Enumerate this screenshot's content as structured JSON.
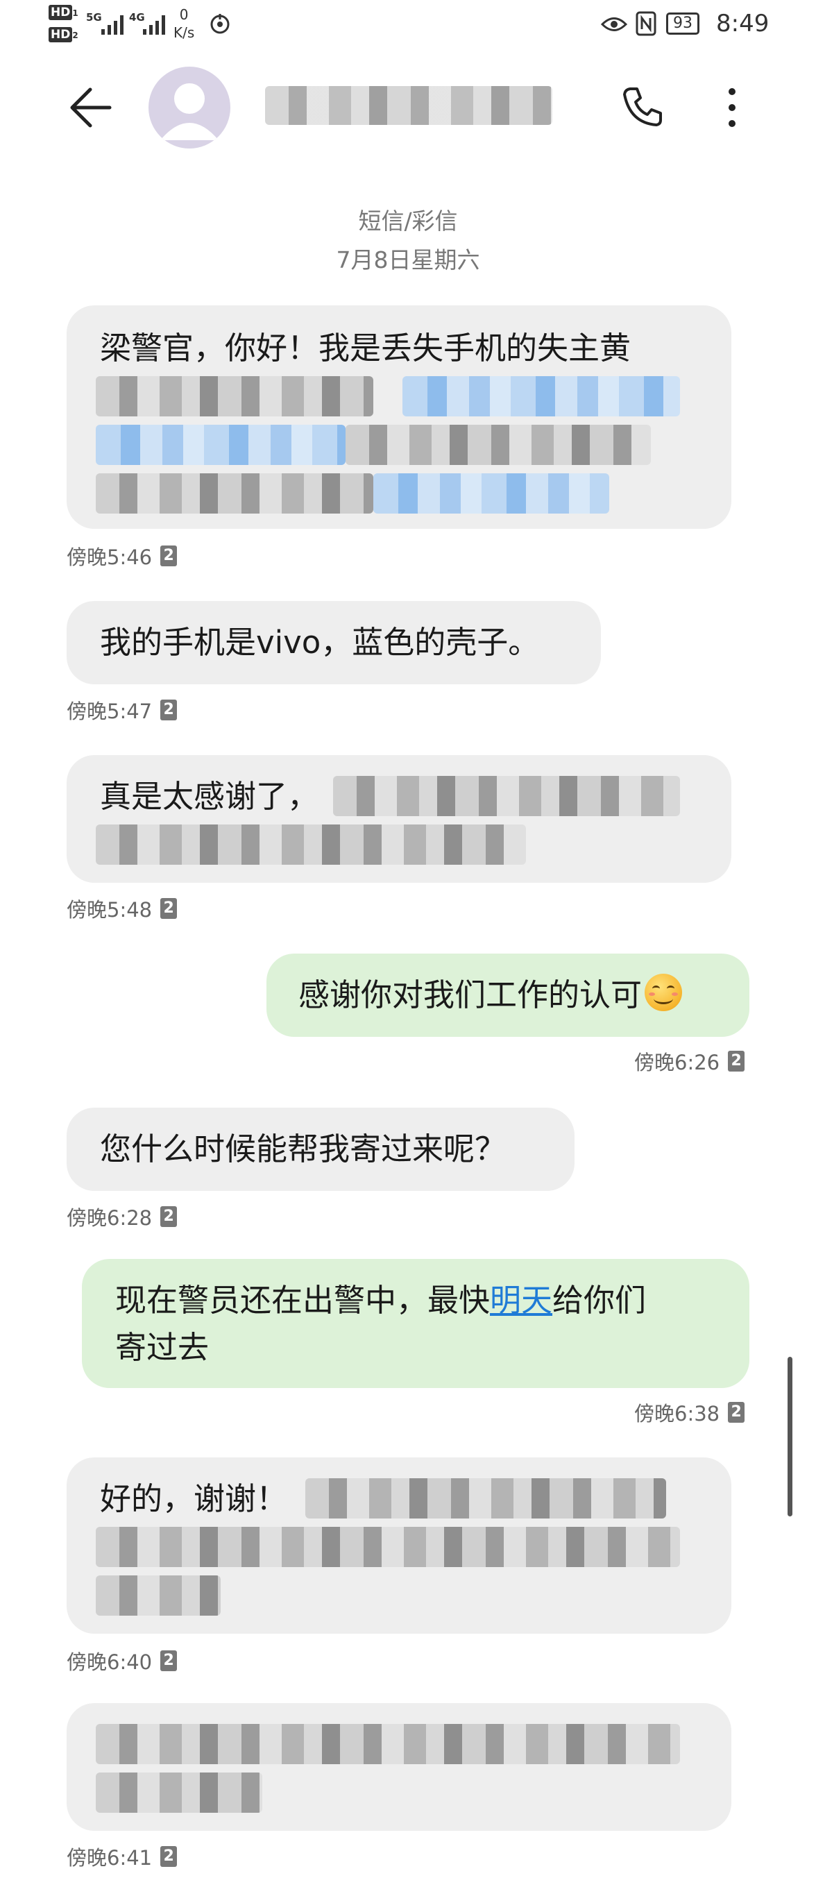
{
  "status_bar": {
    "hd1": "HD",
    "hd2": "HD",
    "net1": "5G",
    "net2": "4G",
    "speed_value": "0",
    "speed_unit": "K/s",
    "battery": "93",
    "time": "8:49"
  },
  "header": {
    "contact_name_redacted": "",
    "icons": [
      "back-arrow-icon",
      "avatar-person-icon",
      "phone-icon",
      "more-vertical-icon"
    ]
  },
  "thread": {
    "type_label": "短信/彩信",
    "date": "7月8日星期六"
  },
  "messages": [
    {
      "direction": "in",
      "text": "梁警官，你好！我是丢失手机的失主黄",
      "time": "傍晚5:46",
      "sim": "2"
    },
    {
      "direction": "in",
      "text": "我的手机是vivo，蓝色的壳子。",
      "time": "傍晚5:47",
      "sim": "2"
    },
    {
      "direction": "in",
      "text": "真是太感谢了，",
      "time": "傍晚5:48",
      "sim": "2"
    },
    {
      "direction": "out",
      "text": "感谢你对我们工作的认可",
      "emoji": "smiling-face-emoji",
      "time": "傍晚6:26",
      "sim": "2"
    },
    {
      "direction": "in",
      "text": "您什么时候能帮我寄过来呢？",
      "time": "傍晚6:28",
      "sim": "2"
    },
    {
      "direction": "out",
      "text_before": "现在警员还在出警中，最快",
      "link": "明天",
      "text_after": "给你们",
      "text_line2": "寄过去",
      "time": "傍晚6:38",
      "sim": "2"
    },
    {
      "direction": "in",
      "text": "好的，谢谢！",
      "time": "傍晚6:40",
      "sim": "2"
    },
    {
      "direction": "in",
      "text": "",
      "time": "傍晚6:41",
      "sim": "2"
    }
  ],
  "colors": {
    "incoming_bubble": "#eeeeee",
    "outgoing_bubble": "#ddf2d8",
    "link": "#1f7bd6"
  }
}
